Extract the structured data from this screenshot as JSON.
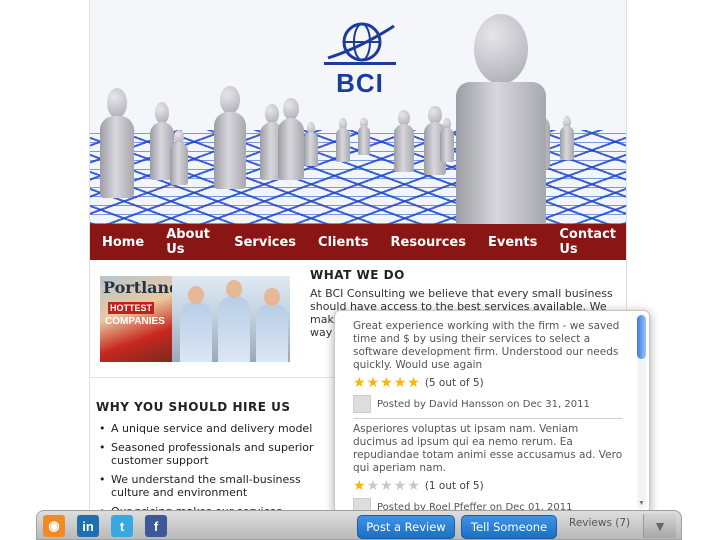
{
  "brand": {
    "logo_text": "BCI"
  },
  "nav": {
    "items": [
      "Home",
      "About Us",
      "Services",
      "Clients",
      "Resources",
      "Events",
      "Contact Us"
    ]
  },
  "what_we_do": {
    "title": "WHAT WE DO",
    "text_lines": [
      "At BCI Consulting we believe that every small business",
      "should have access to the best services available. We",
      "make",
      "way"
    ]
  },
  "photo": {
    "mag_title": "Portland",
    "mag_badge": "HOTTEST",
    "mag_sub": "COMPANIES"
  },
  "why": {
    "title": "WHY YOU SHOULD HIRE US",
    "items": [
      "A unique service and delivery model",
      "Seasoned professionals and superior customer support",
      "We understand the small-business culture and environment",
      "Our pricing makes our services accessible"
    ]
  },
  "reviews": [
    {
      "text": "Great experience working with the firm - we saved time and $ by using their services to select a software development firm. Understood our needs quickly. Would use again",
      "rating": 5,
      "rating_label": "(5 out of 5)",
      "byline": "Posted by David Hansson on Dec 31, 2011"
    },
    {
      "text": "Asperiores voluptas ut ipsam nam. Veniam ducimus ad ipsum qui ea nemo rerum. Ea repudiandae totam animi esse accusamus ad. Vero qui aperiam nam.",
      "rating": 1,
      "rating_label": "(1 out of 5)",
      "byline": "Posted by Roel Pfeffer on Dec 01, 2011"
    }
  ],
  "bottom_bar": {
    "social": [
      {
        "icon": "rss-icon",
        "glyph": "◉",
        "color": "#f08a24"
      },
      {
        "icon": "linkedin-icon",
        "glyph": "in",
        "color": "#1f6fb0"
      },
      {
        "icon": "twitter-icon",
        "glyph": "t",
        "color": "#3aa8e0"
      },
      {
        "icon": "facebook-icon",
        "glyph": "f",
        "color": "#3b5998"
      }
    ],
    "post_review": "Post a Review",
    "tell_someone": "Tell Someone",
    "reviews_tab": "Reviews",
    "reviews_count": "(7)"
  },
  "colors": {
    "nav_bg": "#8a1515",
    "button_blue": "#1b6fc4",
    "star": "#f5b800"
  }
}
